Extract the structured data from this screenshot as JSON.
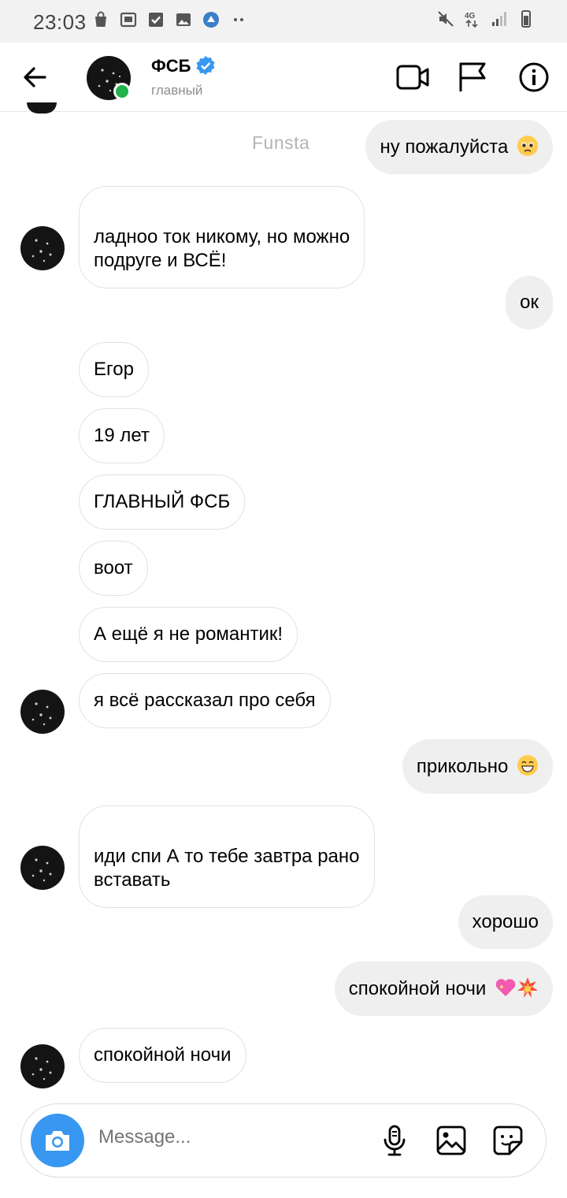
{
  "status_bar": {
    "time": "23:03",
    "left_icons": [
      "bag-icon",
      "safe-icon",
      "check-icon",
      "image-icon",
      "app-icon",
      "more-dots-icon"
    ],
    "right_icons": [
      "mute-icon",
      "4g-icon",
      "signal-icon",
      "battery-icon"
    ],
    "network": "4G"
  },
  "header": {
    "contact_name": "ФСБ",
    "contact_subtitle": "главный",
    "verified": true,
    "online": true,
    "watermark": "Funsta"
  },
  "messages": [
    {
      "side": "out",
      "text": "ну пожалуйста",
      "emoji": "pleading-face"
    },
    {
      "side": "in",
      "text": "ладноо ток никому, но можно\nподруге и ВСЁ!",
      "avatar": true
    },
    {
      "side": "out",
      "text": "ок"
    },
    {
      "side": "in",
      "text": "Егор"
    },
    {
      "side": "in",
      "text": "19 лет"
    },
    {
      "side": "in",
      "text": "ГЛАВНЫЙ ФСБ"
    },
    {
      "side": "in",
      "text": "воот"
    },
    {
      "side": "in",
      "text": "А ещё я не романтик!"
    },
    {
      "side": "in",
      "text": "я всё рассказал про себя",
      "avatar": true
    },
    {
      "side": "out",
      "text": "прикольно",
      "emoji": "grinning-face"
    },
    {
      "side": "in",
      "text": "иди спи А то тебе завтра рано\nвставать",
      "avatar": true
    },
    {
      "side": "out",
      "text": "хорошо"
    },
    {
      "side": "out",
      "text": "спокойной ночи",
      "emoji": "sparkling-heart-collision"
    },
    {
      "side": "in",
      "text": "спокойной ночи",
      "avatar": true
    }
  ],
  "composer": {
    "placeholder": "Message...",
    "icons": [
      "camera-icon",
      "microphone-icon",
      "gallery-icon",
      "sticker-icon"
    ]
  },
  "colors": {
    "accent_blue": "#3897f0",
    "online_green": "#22b14c",
    "outgoing_bubble": "#efefef",
    "incoming_border": "#e2e2e2"
  }
}
